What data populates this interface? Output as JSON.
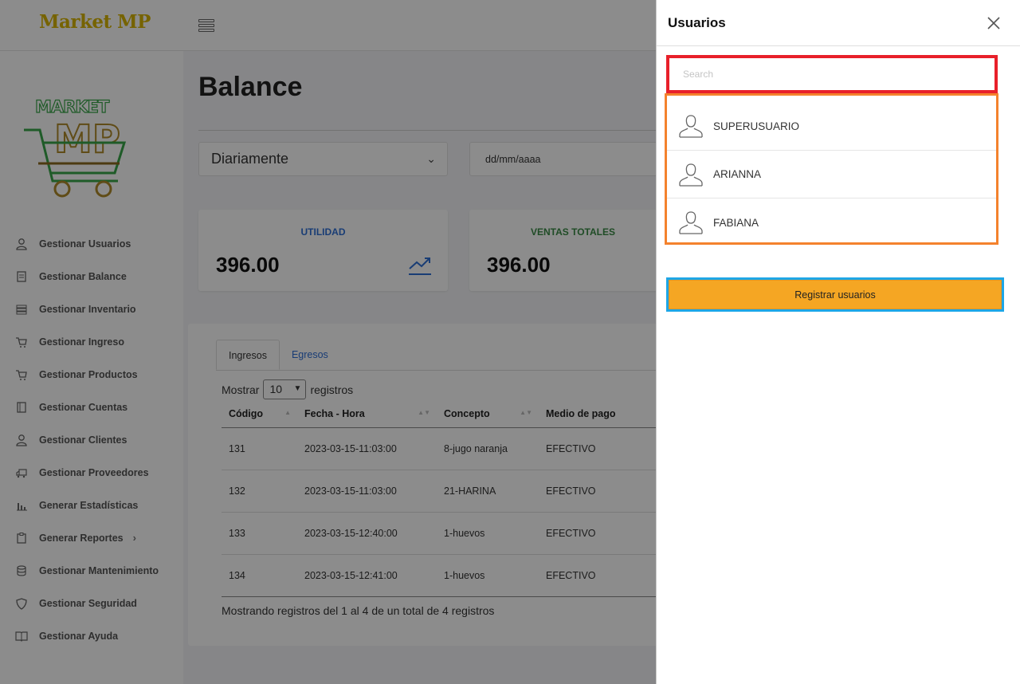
{
  "app": {
    "brand": "Market MP",
    "logo_text": "MARKET MP"
  },
  "sidebar": {
    "items": [
      {
        "label": "Gestionar Usuarios",
        "icon": "user-icon"
      },
      {
        "label": "Gestionar Balance",
        "icon": "ledger-icon"
      },
      {
        "label": "Gestionar Inventario",
        "icon": "inventory-icon"
      },
      {
        "label": "Gestionar Ingreso",
        "icon": "cart-icon"
      },
      {
        "label": "Gestionar Productos",
        "icon": "cart-icon"
      },
      {
        "label": "Gestionar Cuentas",
        "icon": "book-icon"
      },
      {
        "label": "Gestionar Clientes",
        "icon": "user-icon"
      },
      {
        "label": "Gestionar Proveedores",
        "icon": "truck-icon"
      },
      {
        "label": "Generar Estadísticas",
        "icon": "bar-chart-icon"
      },
      {
        "label": "Generar Reportes",
        "icon": "clipboard-icon"
      },
      {
        "label": "Gestionar Mantenimiento",
        "icon": "database-icon"
      },
      {
        "label": "Gestionar Seguridad",
        "icon": "shield-icon"
      },
      {
        "label": "Gestionar Ayuda",
        "icon": "open-book-icon"
      }
    ]
  },
  "main": {
    "title": "Balance",
    "period_select": "Diariamente",
    "date_placeholder": "dd/mm/aaaa",
    "cards": [
      {
        "label": "UTILIDAD",
        "value": "396.00"
      },
      {
        "label": "VENTAS TOTALES",
        "value": "396.00"
      }
    ],
    "tabs": [
      "Ingresos",
      "Egresos"
    ],
    "length": {
      "prefix": "Mostrar",
      "value": "10",
      "suffix": "registros"
    },
    "table": {
      "headers": [
        "Código",
        "Fecha - Hora",
        "Concepto",
        "Medio de pago"
      ],
      "rows": [
        [
          "131",
          "2023-03-15-11:03:00",
          "8-jugo naranja",
          "EFECTIVO"
        ],
        [
          "132",
          "2023-03-15-11:03:00",
          "21-HARINA",
          "EFECTIVO"
        ],
        [
          "133",
          "2023-03-15-12:40:00",
          "1-huevos",
          "EFECTIVO"
        ],
        [
          "134",
          "2023-03-15-12:41:00",
          "1-huevos",
          "EFECTIVO"
        ]
      ]
    },
    "info": "Mostrando registros del 1 al 4 de un total de 4 registros"
  },
  "offcanvas": {
    "title": "Usuarios",
    "search_placeholder": "Search",
    "users": [
      "SUPERUSUARIO",
      "ARIANNA",
      "FABIANA"
    ],
    "register_button": "Registrar usuarios"
  },
  "colors": {
    "brand": "#d8b400",
    "search_highlight": "#e8202a",
    "list_highlight": "#f4822d",
    "button_highlight": "#1ea6e6",
    "register_button": "#f5a623"
  }
}
